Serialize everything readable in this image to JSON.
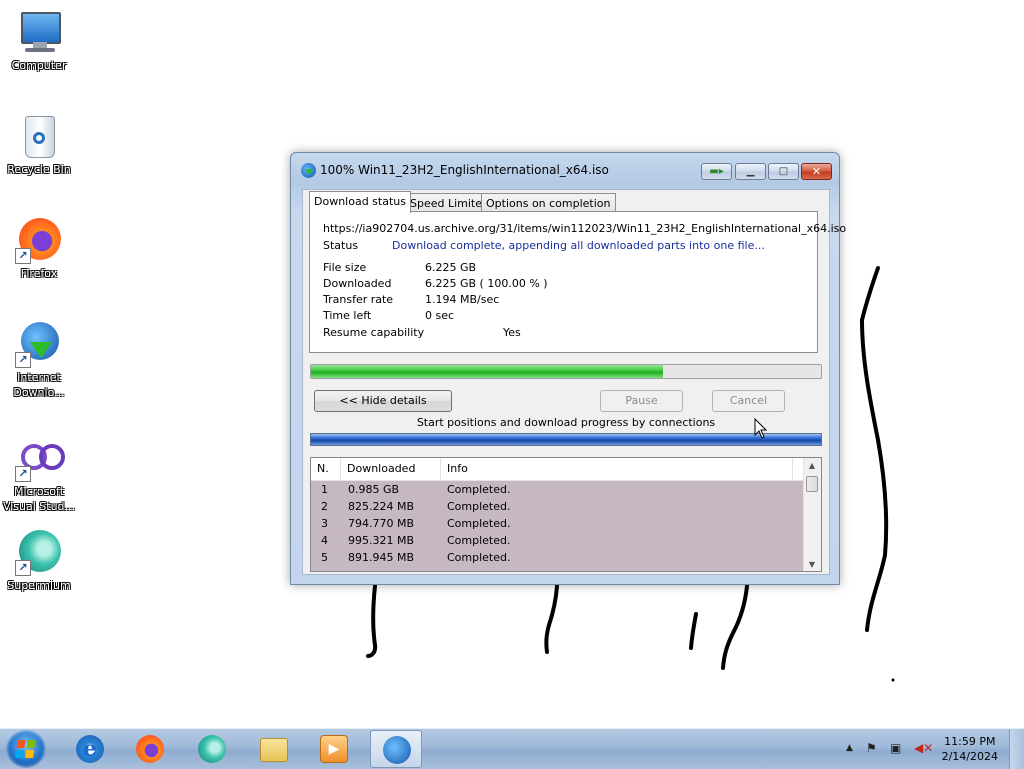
{
  "desktop": {
    "icons": [
      {
        "label": "Computer"
      },
      {
        "label": "Recycle Bin"
      },
      {
        "label": "Firefox"
      },
      {
        "label": "Internet Downlo..."
      },
      {
        "label": "Microsoft Visual Stud..."
      },
      {
        "label": "Supermium"
      }
    ]
  },
  "window": {
    "title": "100% Win11_23H2_EnglishInternational_x64.iso",
    "tabs": [
      "Download status",
      "Speed Limiter",
      "Options on completion"
    ],
    "url": "https://ia902704.us.archive.org/31/items/win112023/Win11_23H2_EnglishInternational_x64.iso",
    "status_label": "Status",
    "status_value": "Download complete, appending all downloaded parts into one file...",
    "fields": [
      {
        "label": "File size",
        "value": "6.225  GB"
      },
      {
        "label": "Downloaded",
        "value": "6.225  GB  ( 100.00 % )"
      },
      {
        "label": "Transfer rate",
        "value": "1.194  MB/sec"
      },
      {
        "label": "Time left",
        "value": "0 sec"
      },
      {
        "label": "Resume capability",
        "value": "Yes"
      }
    ],
    "progress_fraction": 0.69,
    "buttons": {
      "hide_details": "<< Hide details",
      "pause": "Pause",
      "cancel": "Cancel"
    },
    "connections_label": "Start positions and download progress by connections",
    "table": {
      "headers": [
        "N.",
        "Downloaded",
        "Info"
      ],
      "rows": [
        [
          "1",
          "0.985  GB",
          "Completed."
        ],
        [
          "2",
          "825.224  MB",
          "Completed."
        ],
        [
          "3",
          "794.770  MB",
          "Completed."
        ],
        [
          "4",
          "995.321  MB",
          "Completed."
        ],
        [
          "5",
          "891.945  MB",
          "Completed."
        ]
      ]
    },
    "colors": {
      "status_text": "#1a2f9c",
      "row_bg": "#c5b8c1",
      "progress": "#37c837"
    }
  },
  "taskbar": {
    "apps": [
      "internet-explorer",
      "firefox",
      "supermium",
      "file-explorer",
      "media-player",
      "internet-download-manager"
    ],
    "time": "11:59 PM",
    "date": "2/14/2024"
  }
}
